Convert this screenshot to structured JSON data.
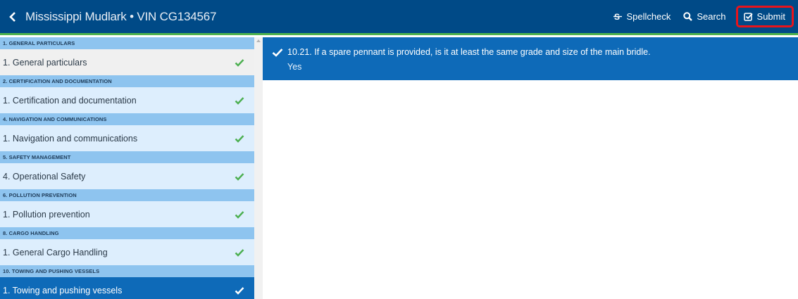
{
  "header": {
    "title": "Mississippi Mudlark • VIN CG134567",
    "actions": {
      "spellcheck_label": "Spellcheck",
      "search_label": "Search",
      "submit_label": "Submit"
    }
  },
  "sidebar": {
    "sections": [
      {
        "header": "1. GENERAL PARTICULARS",
        "item": "1. General particulars",
        "checked": true
      },
      {
        "header": "2. CERTIFICATION AND DOCUMENTATION",
        "item": "1. Certification and documentation",
        "checked": true
      },
      {
        "header": "4. NAVIGATION AND COMMUNICATIONS",
        "item": "1. Navigation and communications",
        "checked": true
      },
      {
        "header": "5. SAFETY MANAGEMENT",
        "item": "4. Operational Safety",
        "checked": true
      },
      {
        "header": "6. POLLUTION PREVENTION",
        "item": "1. Pollution prevention",
        "checked": true
      },
      {
        "header": "8. CARGO HANDLING",
        "item": "1. General Cargo Handling",
        "checked": true
      },
      {
        "header": "10. TOWING AND PUSHING VESSELS",
        "item": "1. Towing and pushing vessels",
        "checked": true,
        "active": true
      }
    ]
  },
  "main": {
    "question": "10.21. If a spare pennant is provided, is it at least the same grade and size of the main bridle.",
    "answer": "Yes"
  },
  "colors": {
    "topbar": "#004a87",
    "accent_line": "#4fb34f",
    "active": "#0e6ab8",
    "section_header": "#8ec4ef",
    "item_bg": "#ddeefd",
    "check": "#4caf50",
    "submit_outline": "#e8141b"
  },
  "icons": {
    "back": "chevron-left-icon",
    "spellcheck": "strikethrough-icon",
    "search": "search-icon",
    "submit": "check-square-icon",
    "check": "check-icon"
  }
}
